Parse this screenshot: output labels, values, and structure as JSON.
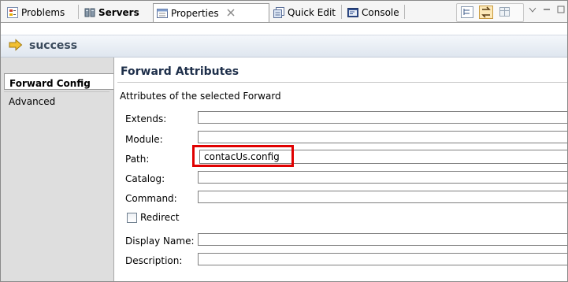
{
  "tabs": [
    {
      "label": "Problems"
    },
    {
      "label": "Servers"
    },
    {
      "label": "Properties"
    },
    {
      "label": "Quick Edit"
    },
    {
      "label": "Console"
    }
  ],
  "icons": {
    "problems": "problems-icon",
    "servers": "servers-icon",
    "properties": "properties-icon",
    "quick_edit": "quick-edit-icon",
    "console": "console-icon",
    "close": "close-icon",
    "title": "forward-arrow-icon"
  },
  "colors": {
    "highlight": "#e00000",
    "title_text": "#3a4a5c",
    "section_title": "#1e2f4a"
  },
  "title_bar": {
    "text": "success"
  },
  "nav": {
    "items": [
      {
        "label": "Forward Config",
        "selected": true
      },
      {
        "label": "Advanced",
        "selected": false
      }
    ]
  },
  "section": {
    "title": "Forward Attributes",
    "description": "Attributes of the selected Forward"
  },
  "fields": {
    "extends": {
      "label": "Extends:",
      "value": ""
    },
    "module": {
      "label": "Module:",
      "value": ""
    },
    "path": {
      "label": "Path:",
      "value": "contacUs.config"
    },
    "catalog": {
      "label": "Catalog:",
      "value": ""
    },
    "command": {
      "label": "Command:",
      "value": ""
    },
    "redirect": {
      "label": "Redirect",
      "checked": false
    },
    "display_name": {
      "label": "Display Name:",
      "value": ""
    },
    "description": {
      "label": "Description:",
      "value": ""
    }
  }
}
